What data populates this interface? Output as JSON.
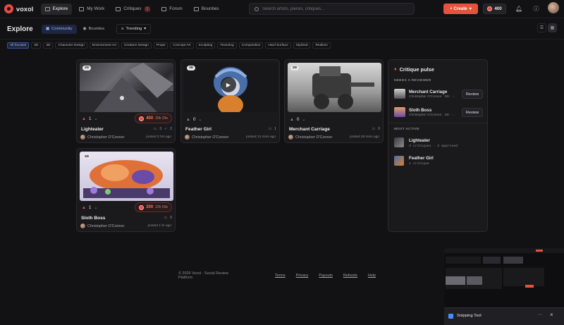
{
  "app": {
    "name": "voxol"
  },
  "nav": {
    "items": [
      {
        "label": "Explore",
        "active": true
      },
      {
        "label": "My Work"
      },
      {
        "label": "Critiques",
        "badge": "1"
      },
      {
        "label": "Forum"
      },
      {
        "label": "Bounties"
      }
    ]
  },
  "search": {
    "placeholder": "Search artists, pieces, critiques..."
  },
  "header": {
    "create_label": "+ Create",
    "credits": "400"
  },
  "subbar": {
    "title": "Explore",
    "tabs": [
      "Community",
      "Bounties"
    ],
    "sort_label": "Trending"
  },
  "filters": [
    "All focuses",
    "3D",
    "3D",
    "Character Design",
    "Environment Art",
    "Creature Design",
    "Props",
    "Concept Art",
    "Sculpting",
    "Texturing",
    "Composition",
    "Hard Surface",
    "Stylized",
    "Realism"
  ],
  "cards": [
    {
      "dim": "2D",
      "votes": "1",
      "bounty": "400",
      "bounty_time": "20h 29s",
      "critiques": "3",
      "approved": "2",
      "title": "Lighteater",
      "author": "Christopher O'Connor",
      "posted": "posted 2 hrs ago"
    },
    {
      "dim": "3D",
      "votes": "0",
      "comments": "1",
      "title": "Feather Girl",
      "author": "Christopher O'Connor",
      "posted": "posted 13 mins ago"
    },
    {
      "dim": "2D",
      "votes": "0",
      "comments": "0",
      "title": "Merchant Carriage",
      "author": "Christopher O'Connor",
      "posted": "posted 28 mins ago"
    },
    {
      "dim": "2D",
      "votes": "1",
      "bounty": "200",
      "bounty_time": "22h 59s",
      "comments": "0",
      "title": "Sloth Boss",
      "author": "Christopher O'Connor",
      "posted": "posted 1 hr ago"
    }
  ],
  "pulse": {
    "title": "Critique pulse",
    "needs_label": "NEEDS A REVIEWER",
    "needs": [
      {
        "name": "Merchant Carriage",
        "sub": "Christopher O'Connor · 3D · ...",
        "action": "Review"
      },
      {
        "name": "Sloth Boss",
        "sub": "Christopher O'Connor · 3D · ...",
        "action": "Review"
      }
    ],
    "active_label": "MOST ACTIVE",
    "active": [
      {
        "name": "Lighteater",
        "sub": "3 critiques · 2 approved"
      },
      {
        "name": "Feather Girl",
        "sub": "1 critique"
      }
    ]
  },
  "footer": {
    "copyright": "© 2026 Voxol · Social Review Platform",
    "links": [
      "Terms",
      "Privacy",
      "Payouts",
      "Refunds",
      "Help"
    ]
  },
  "snipping": {
    "label": "Snipping Tool"
  },
  "colors": {
    "accent": "#e5533f",
    "community": "#9fb4ff",
    "bg": "#121214"
  }
}
